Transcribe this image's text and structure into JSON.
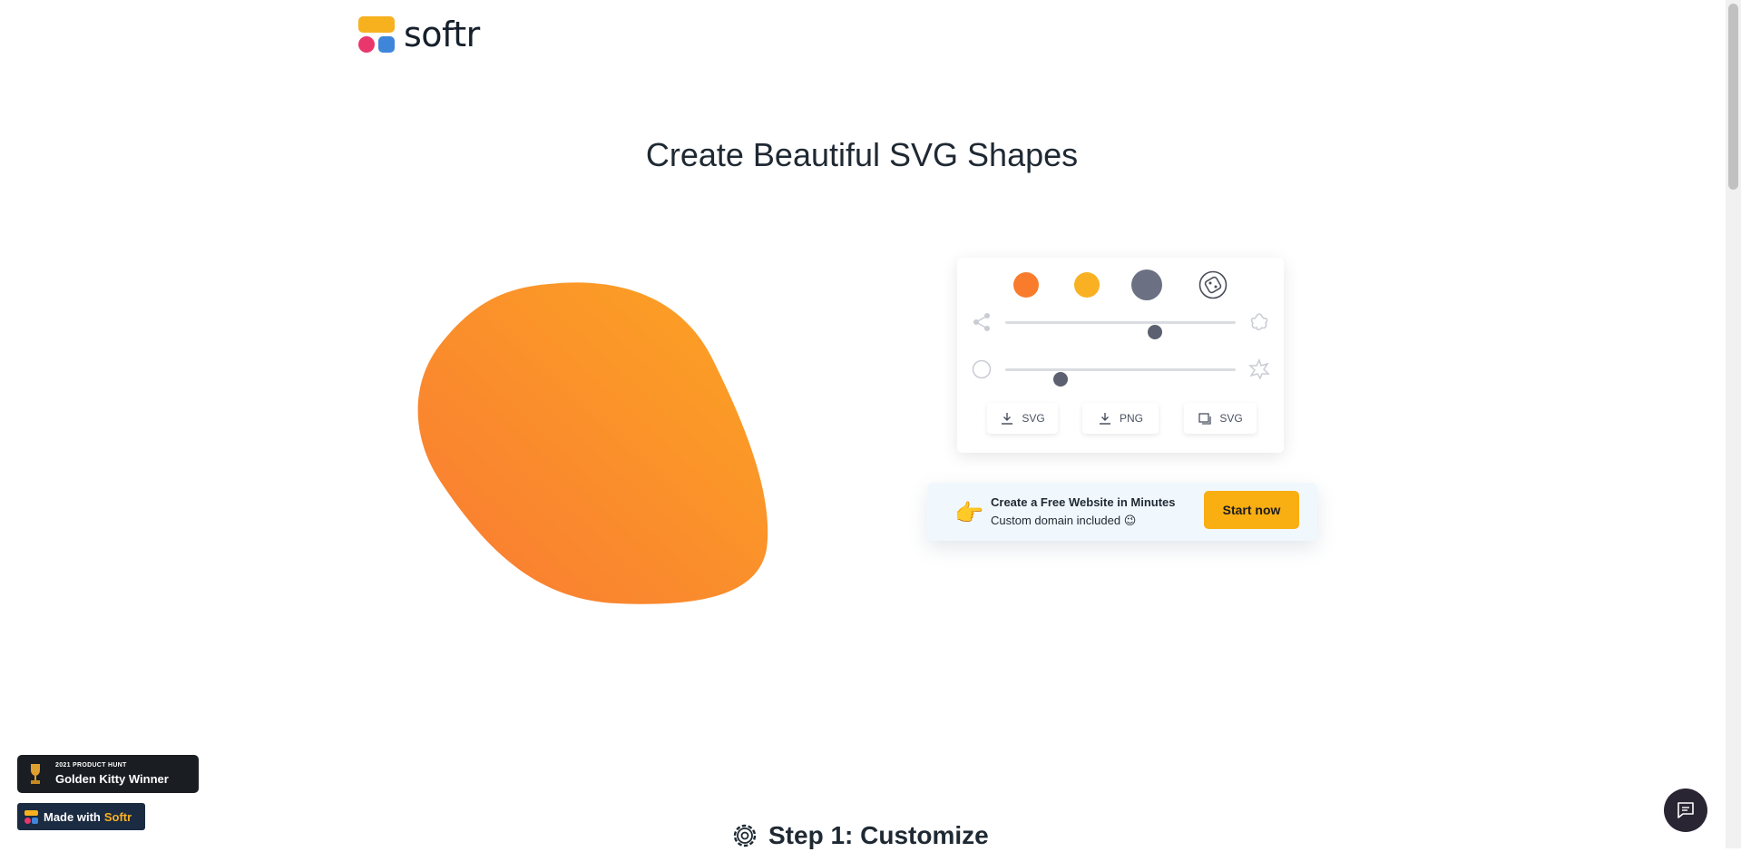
{
  "header": {
    "logo_text": "softr"
  },
  "hero": {
    "title": "Create Beautiful SVG Shapes"
  },
  "blob": {
    "colors": {
      "gradient_start": "#f97a33",
      "gradient_end": "#fca423"
    }
  },
  "controls": {
    "swatches": [
      {
        "name": "orange",
        "color": "#f97c2c"
      },
      {
        "name": "yellow",
        "color": "#f9b023"
      },
      {
        "name": "gray",
        "color": "#6b7082"
      }
    ],
    "random_icon": "dice-icon",
    "complexity": {
      "min_icon": "share-nodes-icon",
      "max_icon": "flower-shape-icon",
      "value": 0.65
    },
    "randomness": {
      "min_icon": "circle-outline-icon",
      "max_icon": "star-burst-icon",
      "value": 0.24
    },
    "buttons": [
      {
        "label": "SVG",
        "icon": "download-icon"
      },
      {
        "label": "PNG",
        "icon": "download-icon"
      },
      {
        "label": "SVG",
        "icon": "copy-icon"
      }
    ]
  },
  "promo": {
    "hand": "👉",
    "title": "Create a Free Website in Minutes",
    "subtitle": "Custom domain included 😉",
    "button": "Start now"
  },
  "badges": {
    "product_hunt_small": "2021 PRODUCT HUNT",
    "product_hunt_big": "Golden Kitty Winner",
    "made_with": "Made with",
    "made_with_brand": "Softr"
  },
  "steps": {
    "step1": "Step 1: Customize"
  },
  "colors": {
    "accent": "#f9ae12",
    "dark": "#1a1d22",
    "thumb": "#5c6070"
  }
}
